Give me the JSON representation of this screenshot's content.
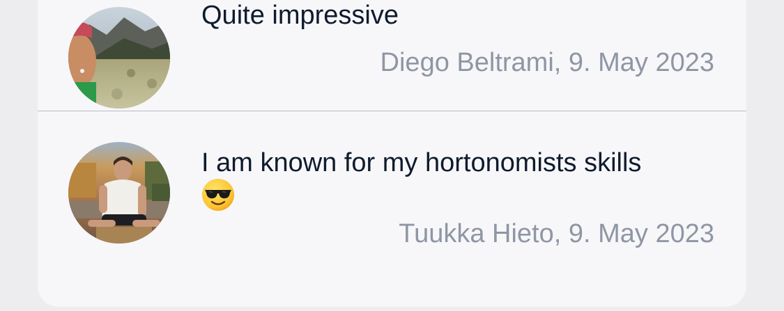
{
  "comments": [
    {
      "avatar_icon": "user-avatar-mountain-photo",
      "text": "Quite impressive",
      "author": "Diego Beltrami",
      "date": "9. May 2023",
      "meta": "Diego Beltrami, 9. May 2023"
    },
    {
      "avatar_icon": "user-avatar-portrait-photo",
      "text": "I am known for my hortonomists skills",
      "emoji": "smiling-face-with-sunglasses",
      "author": "Tuukka Hieto",
      "date": "9. May 2023",
      "meta": "Tuukka Hieto, 9. May 2023"
    }
  ],
  "colors": {
    "card_background": "#f7f7fa",
    "page_background": "#ededf0",
    "text": "#0f1b2d",
    "meta_text": "#8f96a3",
    "divider": "#b9bac4"
  }
}
